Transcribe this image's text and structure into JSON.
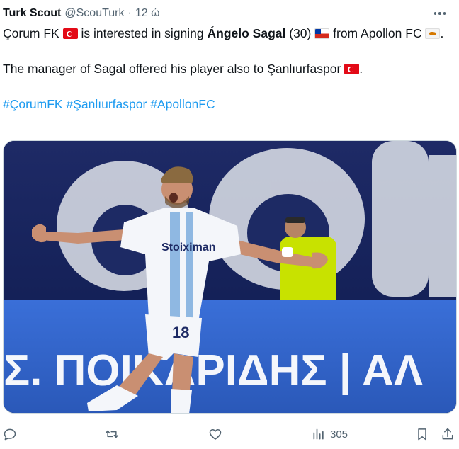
{
  "tweet": {
    "author_name": "Turk Scout",
    "handle": "@ScouTurk",
    "separator": "·",
    "time": "12 ώ",
    "body": {
      "p1_part1": "Çorum FK",
      "p1_part2": "is interested in signing",
      "p1_player": "Ángelo Sagal",
      "p1_part3": "(30)",
      "p1_part4": "from Apollon FC",
      "p1_end": ".",
      "p2_text": "The manager of Sagal offered his player also to Şanlıurfaspor",
      "p2_end": "."
    },
    "hashtags": [
      "#ÇorumFK",
      "#Şanlıurfaspor",
      "#ApollonFC"
    ],
    "media": {
      "banner_text": "Σ. ΠΟΙΚΑΡΙΔΗΣ | ΑΛ",
      "shirt_sponsor": "Stoiximan",
      "shirt_number": "18"
    },
    "actions": {
      "reply_icon": "reply-icon",
      "retweet_icon": "retweet-icon",
      "like_icon": "like-icon",
      "views_icon": "views-icon",
      "views_count": "305",
      "bookmark_icon": "bookmark-icon",
      "share_icon": "share-icon"
    }
  },
  "colors": {
    "text": "#0f1419",
    "secondary": "#536471",
    "link": "#1d9bf0",
    "border": "#cfd9de"
  }
}
